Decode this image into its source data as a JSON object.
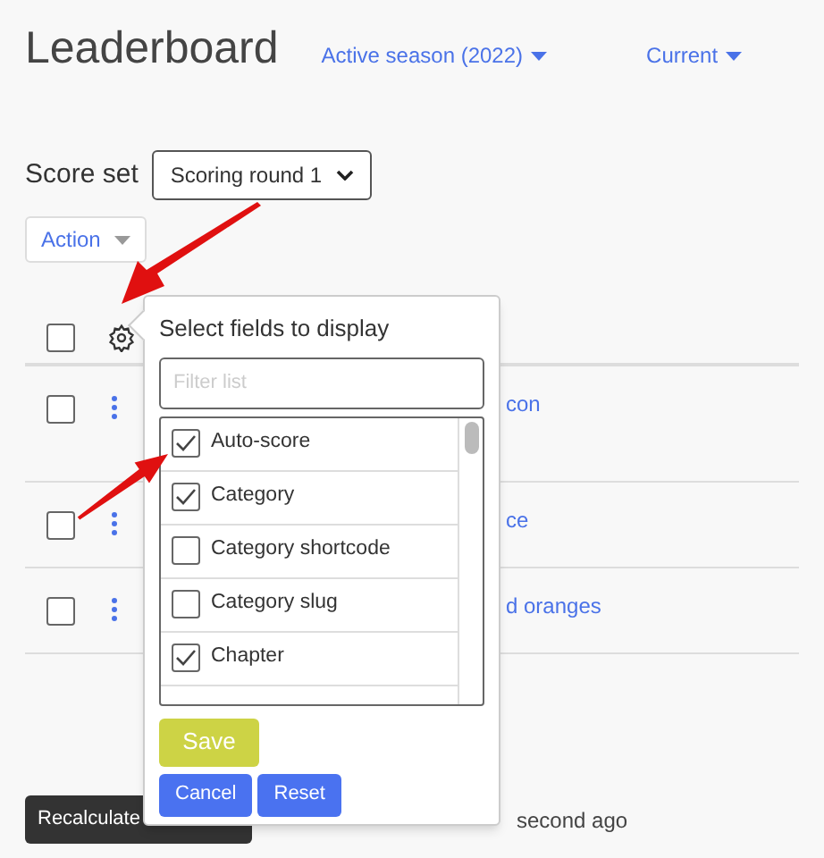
{
  "title": "Leaderboard",
  "filters": [
    {
      "label": "Active season (2022)"
    },
    {
      "label": "Current"
    }
  ],
  "score_set": {
    "label": "Score set",
    "value": "Scoring round 1"
  },
  "action_button": "Action",
  "table": {
    "header": {
      "checked": false
    },
    "rows": [
      {
        "checked": false,
        "text": "con"
      },
      {
        "checked": false,
        "text": "ce"
      },
      {
        "checked": false,
        "text": "d oranges"
      }
    ]
  },
  "popup": {
    "title": "Select fields to display",
    "filter": {
      "placeholder": "Filter list"
    },
    "fields": [
      {
        "label": "Auto-score",
        "checked": true
      },
      {
        "label": "Category",
        "checked": true
      },
      {
        "label": "Category shortcode",
        "checked": false
      },
      {
        "label": "Category slug",
        "checked": false
      },
      {
        "label": "Chapter",
        "checked": true
      }
    ],
    "buttons": [
      {
        "label": "Save",
        "kind": "primary"
      },
      {
        "label": "Cancel",
        "kind": "secondary"
      },
      {
        "label": "Reset",
        "kind": "secondary"
      }
    ]
  },
  "recalculate_button": "Recalculate",
  "status": "second ago"
}
